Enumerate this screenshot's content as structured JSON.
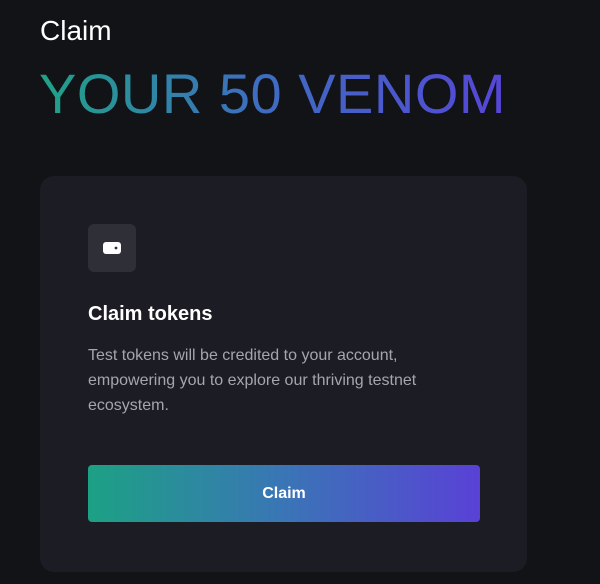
{
  "header": {
    "subtitle": "Claim",
    "title": "YOUR 50 VENOM"
  },
  "card": {
    "icon": "wallet-icon",
    "title": "Claim tokens",
    "description": "Test tokens will be credited to your account, empowering you to explore our thriving testnet ecosystem.",
    "button_label": "Claim"
  },
  "colors": {
    "background": "#121317",
    "card": "#1c1d24",
    "gradient_start": "#1fa386",
    "gradient_end": "#5646d8"
  }
}
